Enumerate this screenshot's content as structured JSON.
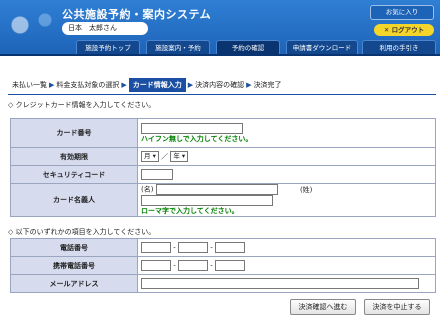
{
  "header": {
    "title": "公共施設予約・案内システム",
    "user_name": "日本　太郎さん",
    "favorite_label": "お気に入り",
    "logout_label": "✕ ログアウト"
  },
  "nav": {
    "tabs": [
      {
        "label": "施設予約トップ"
      },
      {
        "label": "施設案内・予約"
      },
      {
        "label": "予約の確認"
      },
      {
        "label": "申請書ダウンロード"
      },
      {
        "label": "利用の手引き"
      }
    ]
  },
  "steps": [
    {
      "label": "未払い一覧"
    },
    {
      "label": "料金支払対象の選択"
    },
    {
      "label": "カード情報入力"
    },
    {
      "label": "決済内容の確認"
    },
    {
      "label": "決済完了"
    }
  ],
  "card_section": {
    "instruction": "◇ クレジットカード情報を入力してください。",
    "card_number_label": "カード番号",
    "card_number_note": "ハイフン無しで入力してください。",
    "expiry_label": "有効期限",
    "month_label": "月",
    "year_label": "年",
    "slash": "／",
    "security_code_label": "セキュリティコード",
    "cardholder_label": "カード名義人",
    "given_name_label": "(名)",
    "family_name_label": "(姓)",
    "cardholder_note": "ローマ字で入力してください。"
  },
  "contact_section": {
    "instruction": "◇ 以下のいずれかの項目を入力してください。",
    "phone_label": "電話番号",
    "mobile_label": "携帯電話番号",
    "email_label": "メールアドレス",
    "dash": "-"
  },
  "buttons": {
    "confirm_label": "決済確認へ進む",
    "cancel_label": "決済を中止する"
  },
  "colors": {
    "header_blue": "#1d63b8",
    "tab_dark": "#13488f",
    "label_bg": "#d6dbee",
    "note_green": "#008000",
    "logout_yellow": "#f6d52a"
  }
}
